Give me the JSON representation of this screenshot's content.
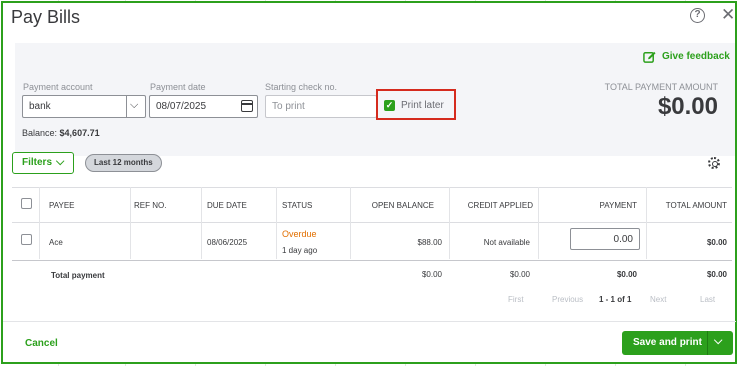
{
  "dialog": {
    "title": "Pay Bills",
    "help_icon": "?",
    "close_icon": "✕"
  },
  "feedback": {
    "label": "Give feedback",
    "icon": "edit-feedback-icon"
  },
  "payment_account": {
    "label": "Payment account",
    "value": "bank"
  },
  "payment_date": {
    "label": "Payment date",
    "value": "08/07/2025"
  },
  "starting_check": {
    "label": "Starting check no.",
    "placeholder": "To print"
  },
  "print_later": {
    "label": "Print later",
    "checked": true
  },
  "balance": {
    "label": "Balance:",
    "value": "$4,607.71"
  },
  "total_payment": {
    "label": "TOTAL PAYMENT AMOUNT",
    "value": "$0.00"
  },
  "filters": {
    "label": "Filters",
    "chip": "Last 12 months"
  },
  "table": {
    "columns": [
      "PAYEE",
      "REF NO.",
      "DUE DATE",
      "STATUS",
      "OPEN BALANCE",
      "CREDIT APPLIED",
      "PAYMENT",
      "TOTAL AMOUNT"
    ],
    "rows": [
      {
        "payee": "Ace",
        "ref_no": "",
        "due_date": "08/06/2025",
        "status": "Overdue",
        "status_sub": "1 day ago",
        "open_balance": "$88.00",
        "credit_applied": "Not available",
        "payment": "0.00",
        "total_amount": "$0.00"
      }
    ],
    "totals": {
      "label": "Total payment",
      "open_balance": "$0.00",
      "credit_applied": "$0.00",
      "payment": "$0.00",
      "total_amount": "$0.00"
    }
  },
  "pagination": {
    "first": "First",
    "previous": "Previous",
    "range": "1 - 1 of 1",
    "next": "Next",
    "last": "Last"
  },
  "footer": {
    "cancel": "Cancel",
    "save_print": "Save and print"
  },
  "colors": {
    "accent": "#2ca01c",
    "overdue": "#e26f00",
    "highlight_border": "#d52b1e"
  }
}
